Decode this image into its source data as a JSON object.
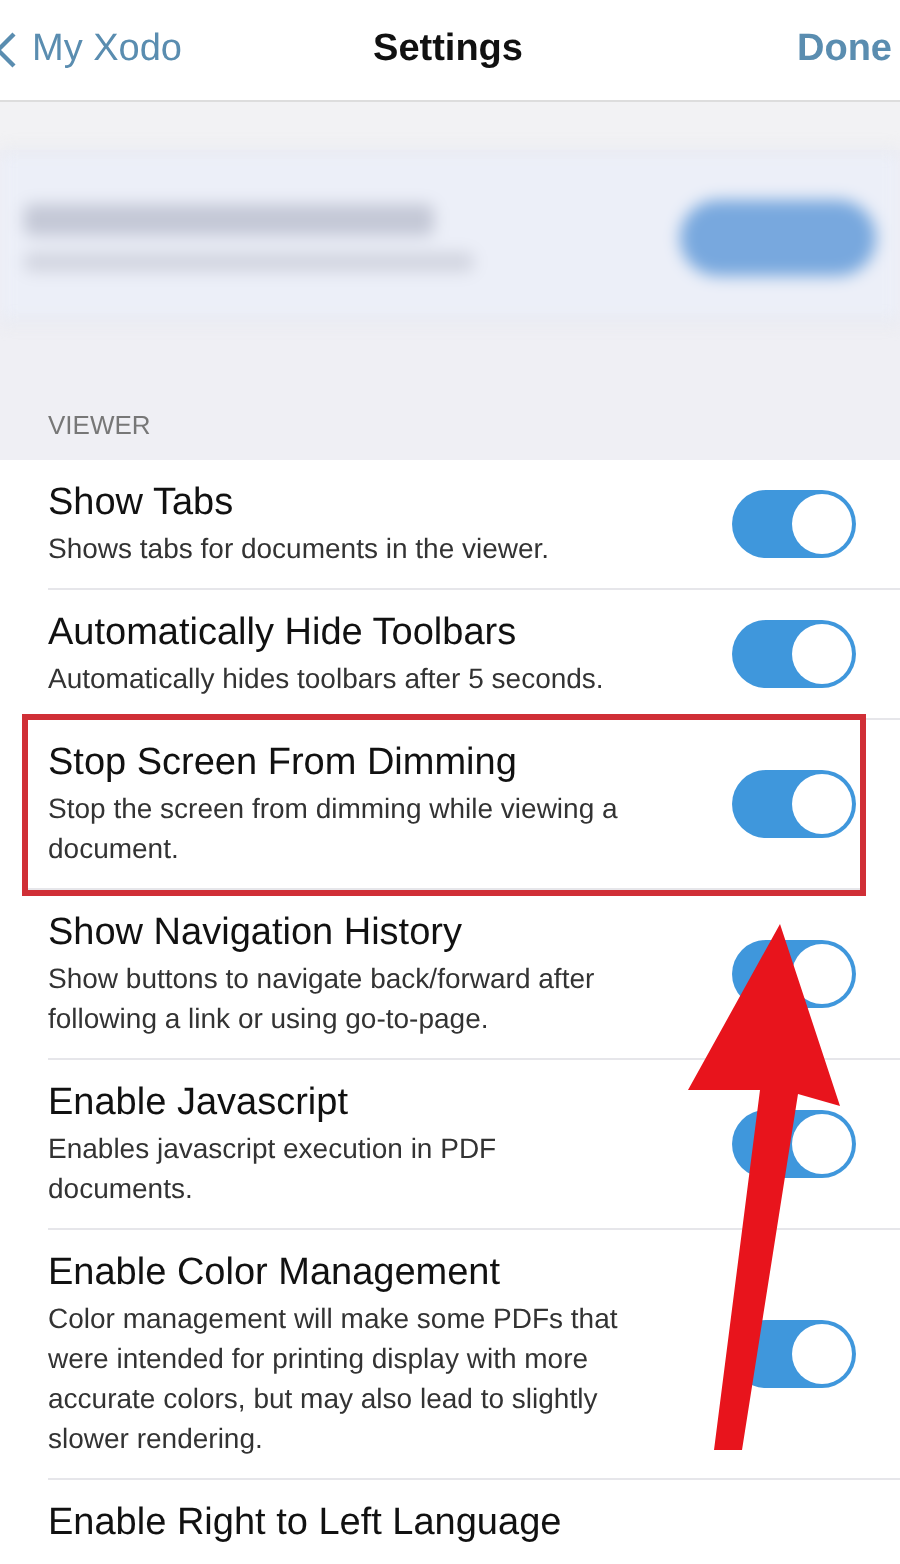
{
  "nav": {
    "back": "My Xodo",
    "title": "Settings",
    "done": "Done"
  },
  "section": "VIEWER",
  "settings": [
    {
      "title": "Show Tabs",
      "description": "Shows tabs for documents in the viewer.",
      "on": true,
      "highlighted": false
    },
    {
      "title": "Automatically Hide Toolbars",
      "description": "Automatically hides toolbars after 5 seconds.",
      "on": true,
      "highlighted": false
    },
    {
      "title": "Stop Screen From Dimming",
      "description": "Stop the screen from dimming while viewing a document.",
      "on": true,
      "highlighted": true
    },
    {
      "title": "Show Navigation History",
      "description": "Show buttons to navigate back/forward after following a link or using go-to-page.",
      "on": true,
      "highlighted": false
    },
    {
      "title": "Enable Javascript",
      "description": "Enables javascript execution in PDF documents.",
      "on": true,
      "highlighted": false
    },
    {
      "title": "Enable Color Management",
      "description": "Color management will make some PDFs that were intended for printing display with more accurate colors, but may also lead to slightly slower rendering.",
      "on": true,
      "highlighted": false
    },
    {
      "title": "Enable Right to Left Language",
      "highlighted": false
    }
  ]
}
